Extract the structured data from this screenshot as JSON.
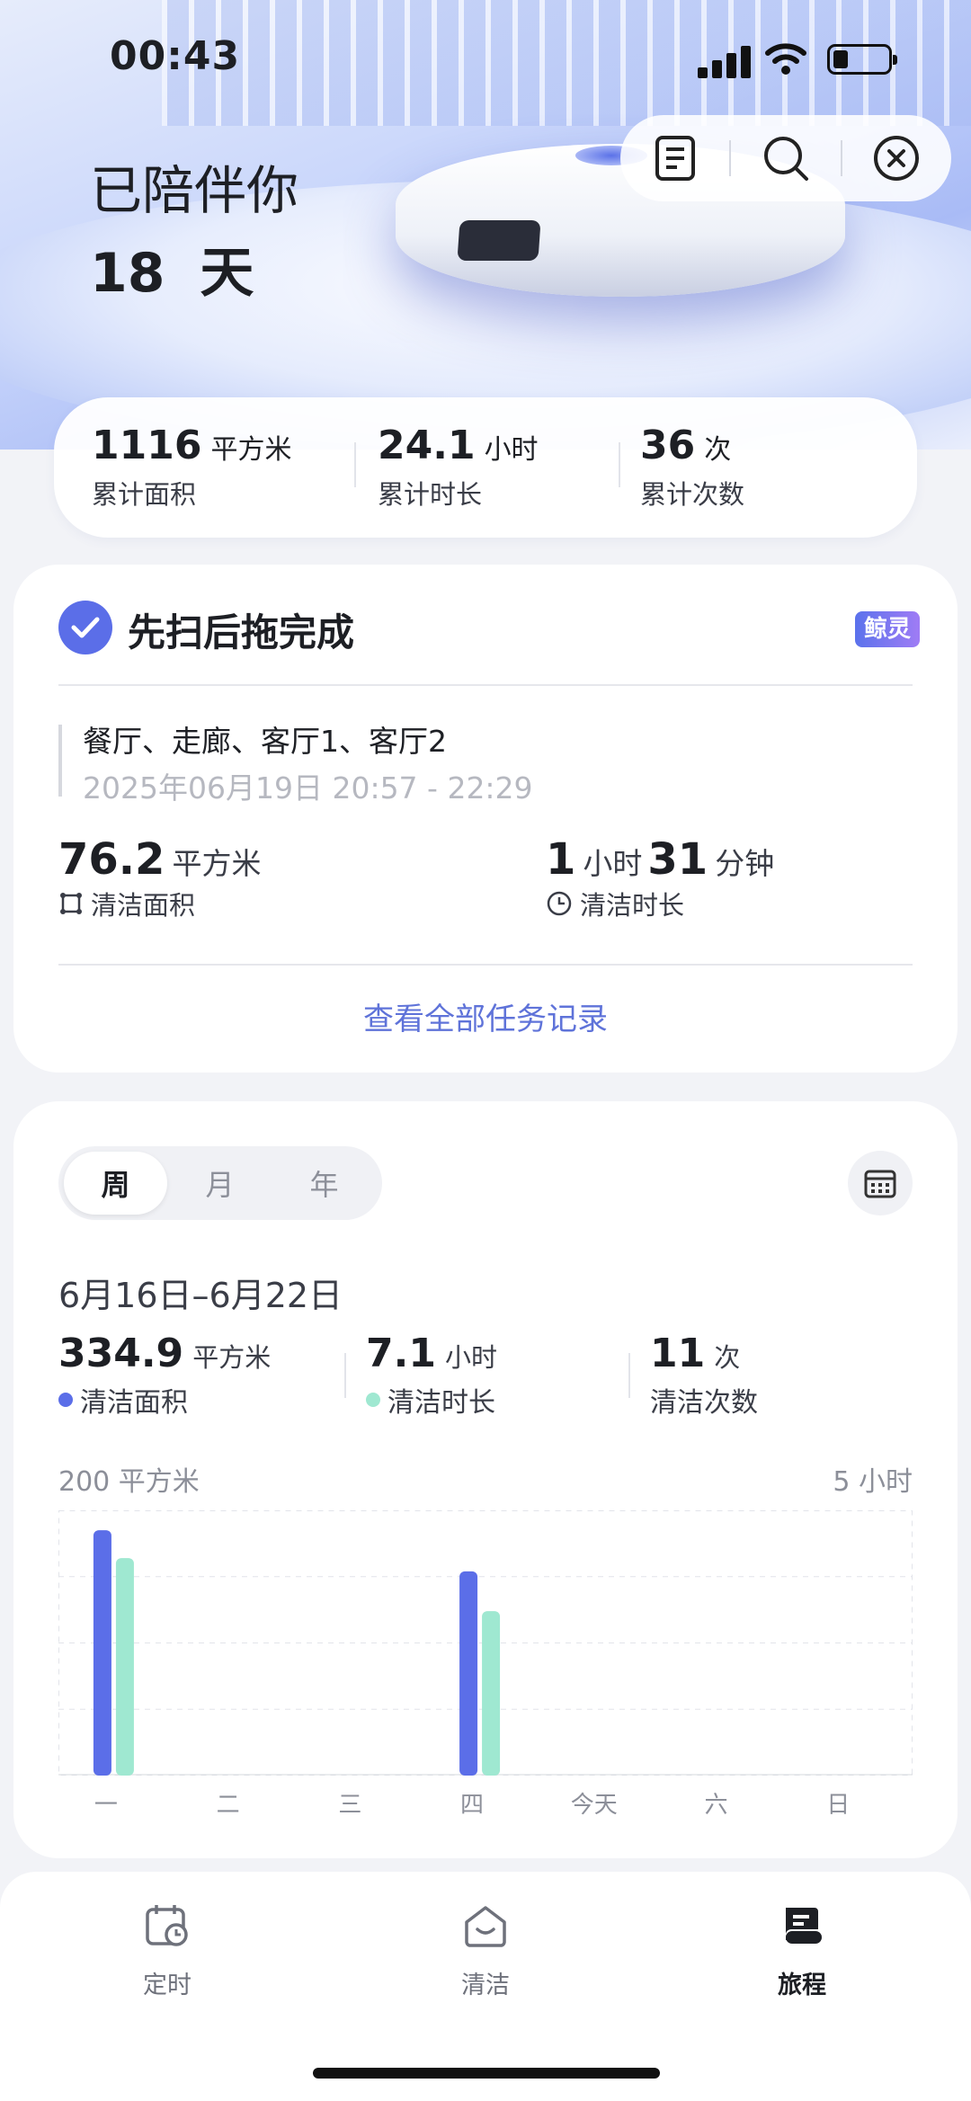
{
  "status_bar": {
    "time": "00:43"
  },
  "hero": {
    "greeting": "已陪伴你",
    "days_value": "18",
    "days_unit": "天"
  },
  "top_actions": [
    "document-icon",
    "search-icon",
    "close-icon"
  ],
  "summary": [
    {
      "value": "1116",
      "unit": "平方米",
      "label": "累计面积"
    },
    {
      "value": "24.1",
      "unit": "小时",
      "label": "累计时长"
    },
    {
      "value": "36",
      "unit": "次",
      "label": "累计次数"
    }
  ],
  "task": {
    "title": "先扫后拖完成",
    "badge": "鲸灵",
    "rooms": "餐厅、走廊、客厅1、客厅2",
    "datetime": "2025年06月19日 20:57 - 22:29",
    "area_value": "76.2",
    "area_unit": "平方米",
    "area_label": "清洁面积",
    "duration_h": "1",
    "duration_h_unit": "小时",
    "duration_m": "31",
    "duration_m_unit": "分钟",
    "duration_label": "清洁时长",
    "view_all": "查看全部任务记录"
  },
  "stats": {
    "tabs": [
      "周",
      "月",
      "年"
    ],
    "active_tab": "周",
    "range": "6月16日–6月22日",
    "area": {
      "value": "334.9",
      "unit": "平方米",
      "label": "清洁面积"
    },
    "duration": {
      "value": "7.1",
      "unit": "小时",
      "label": "清洁时长"
    },
    "count": {
      "value": "11",
      "unit": "次",
      "label": "清洁次数"
    },
    "left_axis": "200 平方米",
    "right_axis": "5 小时"
  },
  "colors": {
    "accent": "#5b6ee8",
    "area_bar": "#5b6ee8",
    "duration_bar": "#9fe8d1",
    "link": "#5f73d9"
  },
  "chart_data": {
    "type": "bar",
    "categories": [
      "一",
      "二",
      "三",
      "四",
      "今天",
      "六",
      "日"
    ],
    "series": [
      {
        "values": [
          185,
          0,
          0,
          154,
          0,
          0,
          0
        ],
        "axis": "left",
        "max": 200
      },
      {
        "values": [
          4.1,
          0,
          0,
          3.1,
          0,
          0,
          0
        ],
        "axis": "right",
        "max": 5
      }
    ],
    "ylabel": "200 平方米",
    "y2label": "5 小时",
    "grid": true
  },
  "tabbar": [
    {
      "label": "定时",
      "icon": "schedule-icon"
    },
    {
      "label": "清洁",
      "icon": "clean-home-icon"
    },
    {
      "label": "旅程",
      "icon": "journey-icon",
      "active": true
    }
  ]
}
